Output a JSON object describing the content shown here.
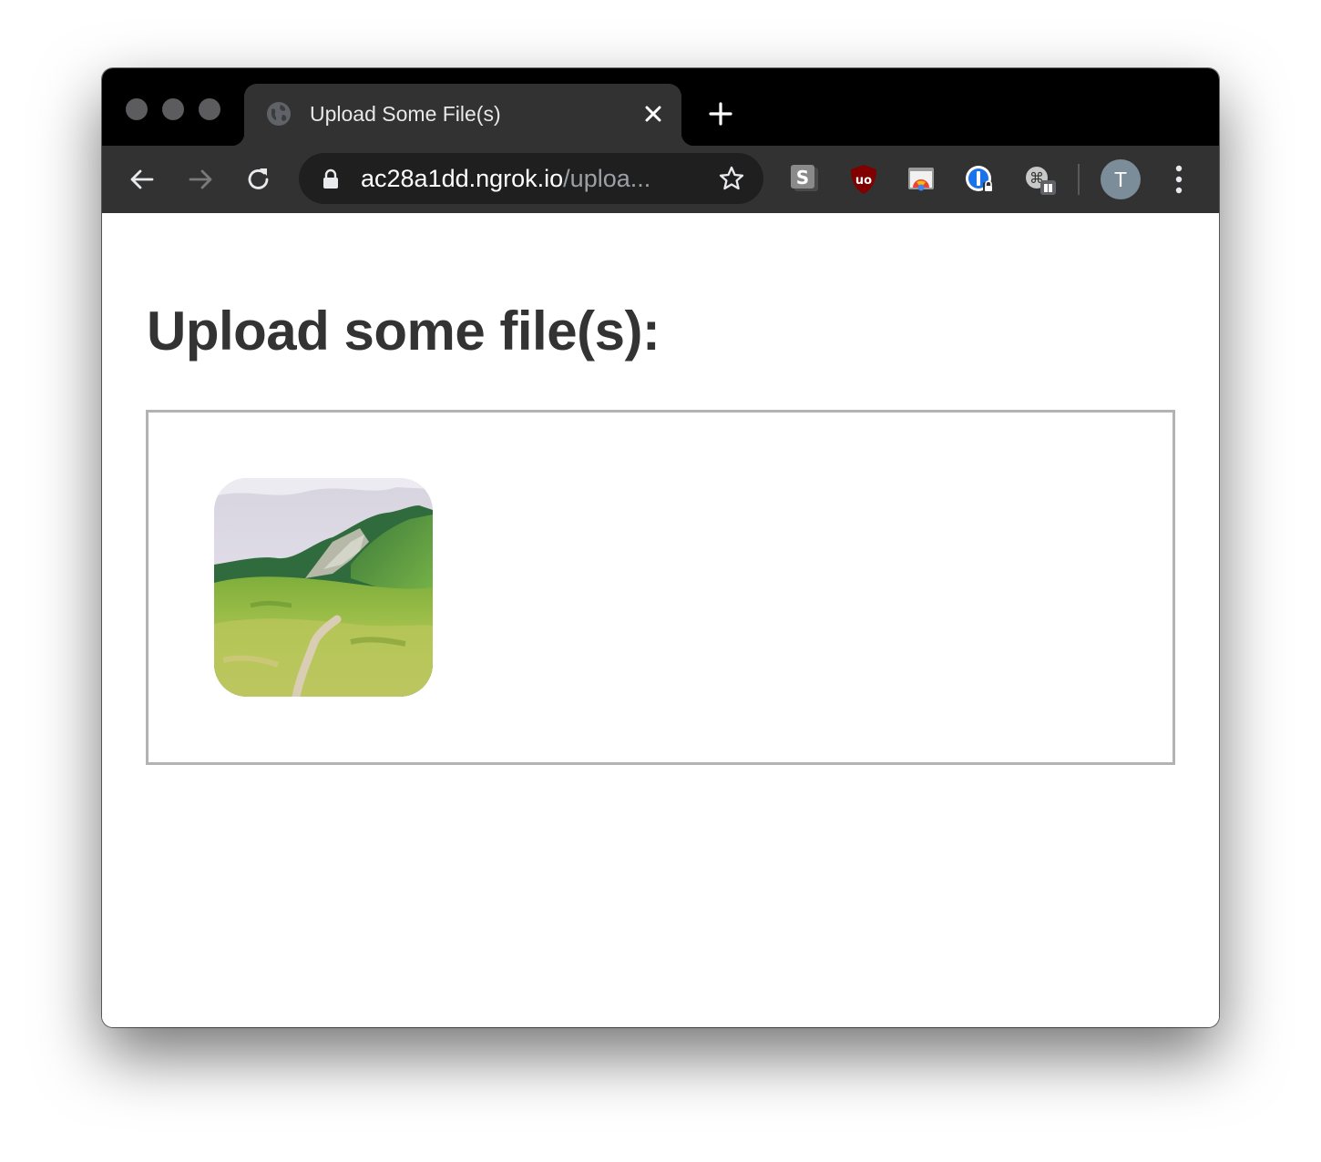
{
  "browser": {
    "tab": {
      "title": "Upload Some File(s)",
      "favicon": "globe-icon"
    },
    "address_bar": {
      "host": "ac28a1dd.ngrok.io",
      "path": "/uploa..."
    },
    "extensions": [
      "scribe-extension-icon",
      "ublock-origin-icon",
      "chrome-cast-icon",
      "1password-icon",
      "shortkeys-icon"
    ],
    "profile_initial": "T"
  },
  "page": {
    "heading": "Upload some file(s):",
    "dropzone": {
      "files": [
        {
          "thumbnail": "mountain-landscape-image"
        }
      ]
    }
  },
  "colors": {
    "tabstrip": "#000000",
    "toolbar": "#323233",
    "heading": "#333333",
    "dropzone_border": "#b3b3b3",
    "avatar": "#7b8d99"
  }
}
